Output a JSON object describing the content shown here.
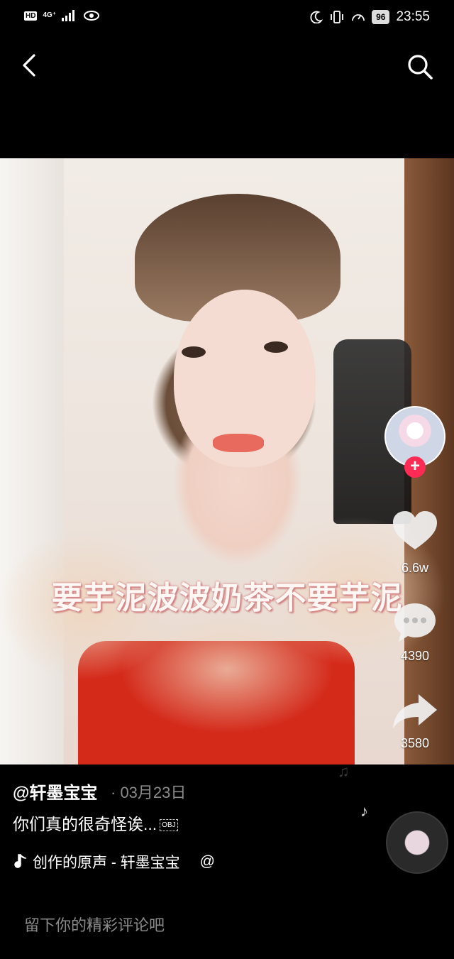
{
  "status_bar": {
    "hd": "HD",
    "network": "4G⁺",
    "time": "23:55",
    "battery": "96"
  },
  "video": {
    "caption": "要芋泥波波奶茶不要芋泥"
  },
  "rail": {
    "likes": "6.6w",
    "comments": "4390",
    "shares": "3580",
    "follow_symbol": "+"
  },
  "post": {
    "author": "@轩墨宝宝",
    "date": "· 03月23日",
    "description": "你们真的很奇怪诶...",
    "desc_obj": "OBJ",
    "music": "创作的原声 - 轩墨宝宝",
    "music_at": "@"
  },
  "comment": {
    "placeholder": "留下你的精彩评论吧"
  },
  "icons": {
    "back": "chevron-left-icon",
    "search": "search-icon",
    "like": "heart-icon",
    "comment": "comment-icon",
    "share": "share-icon",
    "music": "music-note-icon"
  },
  "colors": {
    "accent": "#fe2c55",
    "muted": "#8a8a8a"
  }
}
